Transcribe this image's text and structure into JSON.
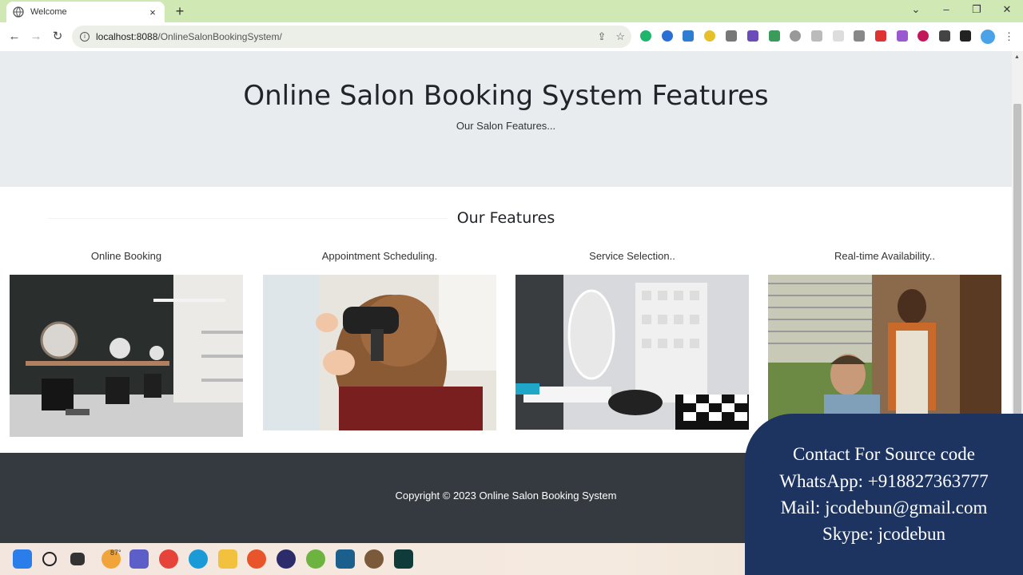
{
  "browser": {
    "tab_title": "Welcome",
    "new_tab": "+",
    "tab_close": "×",
    "url_host": "localhost:8088",
    "url_path": "/OnlineSalonBookingSystem/"
  },
  "hero": {
    "title": "Online Salon Booking System Features",
    "subtitle": "Our Salon Features..."
  },
  "features": {
    "heading": "Our Features",
    "cards": [
      {
        "label": "Online Booking"
      },
      {
        "label": "Appointment Scheduling."
      },
      {
        "label": "Service Selection.."
      },
      {
        "label": "Real-time Availability.."
      }
    ]
  },
  "footer": {
    "copyright": "Copyright © 2023 Online Salon Booking System"
  },
  "overlay": {
    "line1": "Contact For Source code",
    "line2": "WhatsApp:   +918827363777",
    "line3": "Mail: jcodebun@gmail.com",
    "line4": "Skype: jcodebun"
  },
  "taskbar": {
    "weather_temp": "87°"
  },
  "colors": {
    "hero_bg": "#e9ecef",
    "footer_bg": "#343a40",
    "overlay_bg": "#1d3461",
    "tabbar_bg": "#cfe8b4"
  }
}
